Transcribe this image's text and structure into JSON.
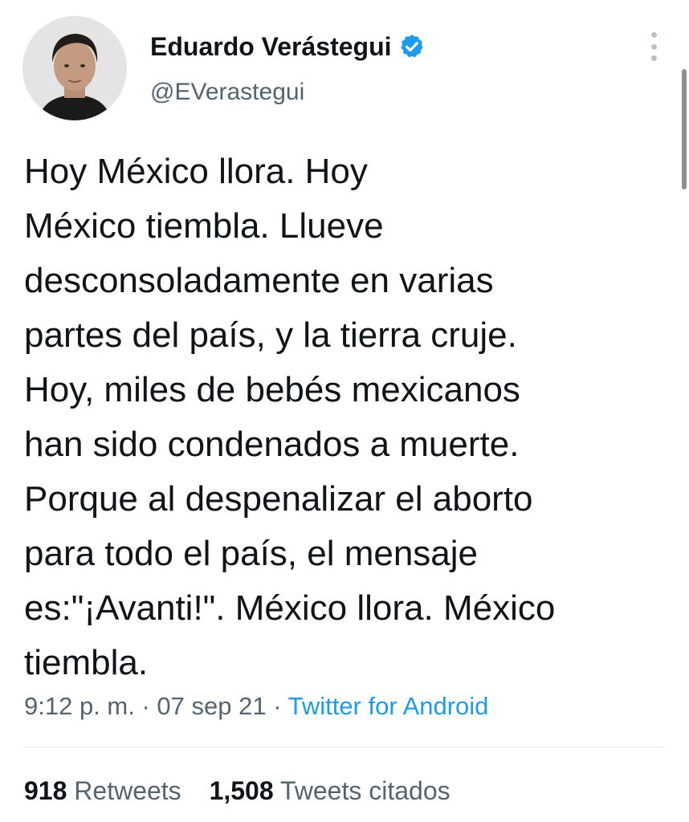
{
  "author": {
    "display_name": "Eduardo Verástegui",
    "handle": "@EVerastegui",
    "verified": true,
    "avatar_icon": "profile-photo"
  },
  "tweet": {
    "lines": [
      "Hoy México llora. Hoy",
      "México tiembla. Llueve",
      "desconsoladamente en varias",
      "partes del país, y la tierra cruje.",
      "Hoy, miles de bebés mexicanos",
      "han sido condenados a muerte.",
      "Porque al despenalizar el aborto",
      "para todo el país, el mensaje",
      "es:\"¡Avanti!\". México llora. México",
      "tiembla."
    ],
    "time": "9:12 p. m.",
    "date": "07 sep 21",
    "separator": " · ",
    "source": "Twitter for Android"
  },
  "stats": {
    "retweets_count": "918",
    "retweets_label": "Retweets",
    "quotes_count": "1,508",
    "quotes_label": "Tweets citados"
  },
  "colors": {
    "text": "#0f1419",
    "secondary": "#536471",
    "link": "#1d9bf0",
    "verified_badge": "#1d9bf0"
  },
  "icons": {
    "verified": "verified-badge-icon",
    "more": "more-options-icon"
  }
}
